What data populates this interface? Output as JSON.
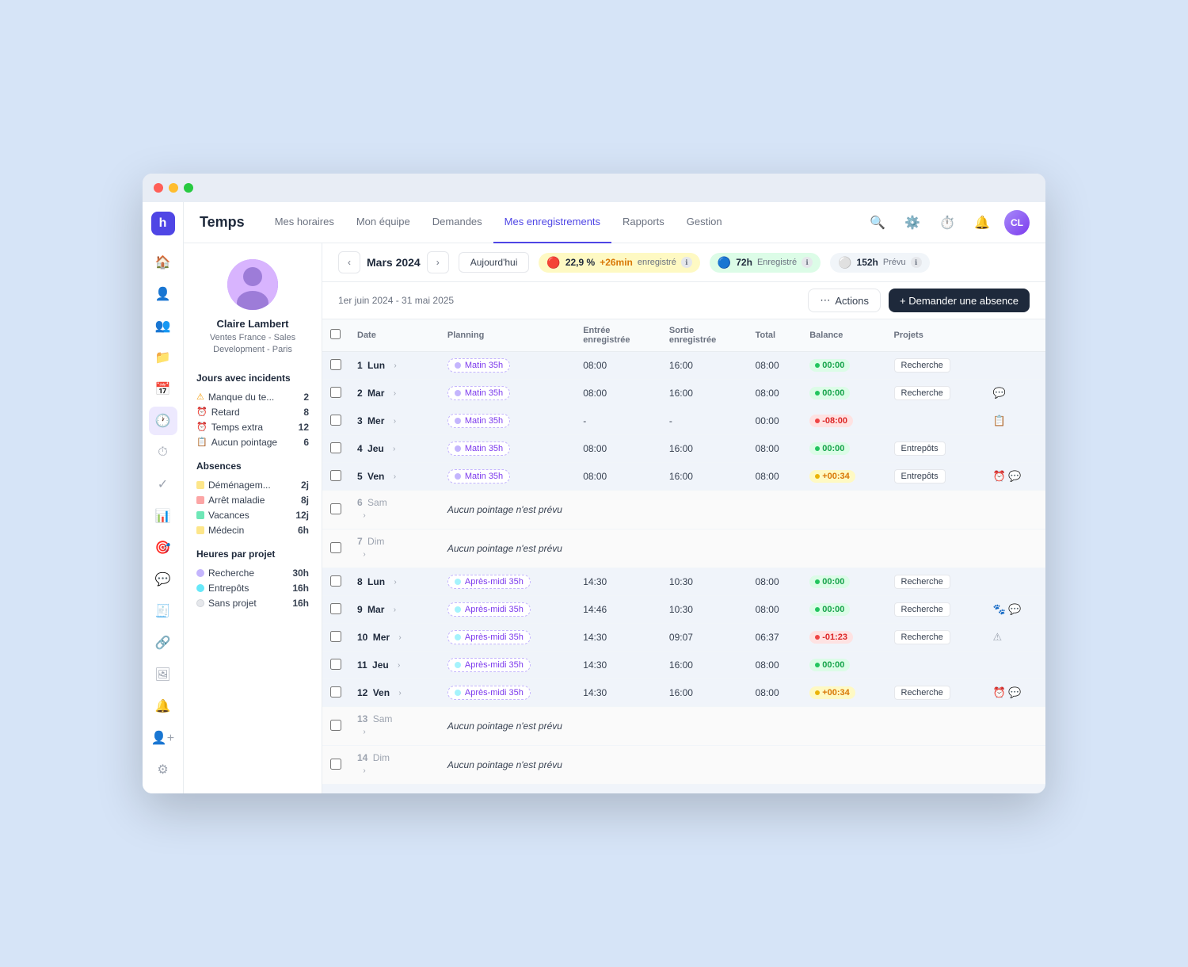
{
  "app": {
    "logo": "h",
    "title": "Temps"
  },
  "topbar": {
    "title": "Temps",
    "nav": [
      {
        "label": "Mes horaires",
        "active": false
      },
      {
        "label": "Mon équipe",
        "active": false
      },
      {
        "label": "Demandes",
        "active": false
      },
      {
        "label": "Mes enregistrements",
        "active": true
      },
      {
        "label": "Rapports",
        "active": false
      },
      {
        "label": "Gestion",
        "active": false
      }
    ]
  },
  "profile": {
    "name": "Claire Lambert",
    "dept": "Ventes France - Sales Development - Paris"
  },
  "date_nav": {
    "prev": "‹",
    "next": "›",
    "current": "Mars 2024",
    "today": "Aujourd'hui"
  },
  "stats": [
    {
      "icon": "🔴",
      "value": "22,9 %",
      "extra": "+26min",
      "label": "enregistré"
    },
    {
      "icon": "🔵",
      "value": "72h",
      "label": "Enregistré"
    },
    {
      "icon": "⚪",
      "value": "152h",
      "label": "Prévu"
    }
  ],
  "date_range": "1er juin 2024 - 31 mai 2025",
  "actions_label": "Actions",
  "request_absence_label": "+ Demander une absence",
  "incidents": {
    "title": "Jours avec incidents",
    "items": [
      {
        "icon": "⚠",
        "label": "Manque du te...",
        "count": "2"
      },
      {
        "icon": "⏰",
        "label": "Retard",
        "count": "8"
      },
      {
        "icon": "⏰",
        "label": "Temps extra",
        "count": "12"
      },
      {
        "icon": "📋",
        "label": "Aucun pointage",
        "count": "6"
      }
    ]
  },
  "absences": {
    "title": "Absences",
    "items": [
      {
        "color": "#fde68a",
        "label": "Déménagem...",
        "value": "2j"
      },
      {
        "color": "#fca5a5",
        "label": "Arrêt maladie",
        "value": "8j"
      },
      {
        "color": "#6ee7b7",
        "label": "Vacances",
        "value": "12j"
      },
      {
        "color": "#fde68a",
        "label": "Médecin",
        "value": "6h"
      }
    ]
  },
  "projects": {
    "title": "Heures par projet",
    "items": [
      {
        "color": "#c4b5fd",
        "label": "Recherche",
        "value": "30h"
      },
      {
        "color": "#67e8f9",
        "label": "Entrepôts",
        "value": "16h"
      },
      {
        "color": "#e5e7eb",
        "label": "Sans projet",
        "value": "16h"
      }
    ]
  },
  "table": {
    "headers": [
      "",
      "Date",
      "Planning",
      "Entrée enregistrée",
      "Sortie enregistrée",
      "Total",
      "Balance",
      "Projets",
      ""
    ],
    "rows": [
      {
        "num": "1",
        "day": "Lun",
        "weekend": false,
        "planning": "Matin 35h",
        "planning_type": "am",
        "entry": "08:00",
        "exit": "16:00",
        "total": "08:00",
        "balance_val": "00:00",
        "balance_type": "green",
        "projects": [
          "Recherche"
        ],
        "icons": [],
        "no_schedule": false
      },
      {
        "num": "2",
        "day": "Mar",
        "weekend": false,
        "planning": "Matin 35h",
        "planning_type": "am",
        "entry": "08:00",
        "exit": "16:00",
        "total": "08:00",
        "balance_val": "00:00",
        "balance_type": "green",
        "projects": [
          "Recherche"
        ],
        "icons": [
          "💬"
        ],
        "no_schedule": false
      },
      {
        "num": "3",
        "day": "Mer",
        "weekend": false,
        "planning": "Matin 35h",
        "planning_type": "am",
        "entry": "-",
        "exit": "-",
        "total": "00:00",
        "balance_val": "-08:00",
        "balance_type": "red",
        "projects": [],
        "icons": [
          "📋"
        ],
        "no_schedule": false
      },
      {
        "num": "4",
        "day": "Jeu",
        "weekend": false,
        "planning": "Matin 35h",
        "planning_type": "am",
        "entry": "08:00",
        "exit": "16:00",
        "total": "08:00",
        "balance_val": "00:00",
        "balance_type": "green",
        "projects": [
          "Entrepôts"
        ],
        "icons": [],
        "no_schedule": false
      },
      {
        "num": "5",
        "day": "Ven",
        "weekend": false,
        "planning": "Matin 35h",
        "planning_type": "am",
        "entry": "08:00",
        "exit": "16:00",
        "total": "08:00",
        "balance_val": "+00:34",
        "balance_type": "yellow",
        "projects": [
          "Entrepôts"
        ],
        "icons": [
          "⏰",
          "💬"
        ],
        "no_schedule": false
      },
      {
        "num": "6",
        "day": "Sam",
        "weekend": true,
        "planning": "",
        "planning_type": "",
        "entry": "",
        "exit": "",
        "total": "",
        "balance_val": "",
        "balance_type": "",
        "projects": [],
        "icons": [],
        "no_schedule": true,
        "no_schedule_text": "Aucun pointage n'est prévu"
      },
      {
        "num": "7",
        "day": "Dim",
        "weekend": true,
        "planning": "",
        "planning_type": "",
        "entry": "",
        "exit": "",
        "total": "",
        "balance_val": "",
        "balance_type": "",
        "projects": [],
        "icons": [],
        "no_schedule": true,
        "no_schedule_text": "Aucun pointage n'est prévu"
      },
      {
        "num": "8",
        "day": "Lun",
        "weekend": false,
        "planning": "Après-midi 35h",
        "planning_type": "pm",
        "entry": "14:30",
        "exit": "10:30",
        "total": "08:00",
        "balance_val": "00:00",
        "balance_type": "green",
        "projects": [
          "Recherche"
        ],
        "icons": [],
        "no_schedule": false
      },
      {
        "num": "9",
        "day": "Mar",
        "weekend": false,
        "planning": "Après-midi 35h",
        "planning_type": "pm",
        "entry": "14:46",
        "exit": "10:30",
        "total": "08:00",
        "balance_val": "00:00",
        "balance_type": "green",
        "projects": [
          "Recherche"
        ],
        "icons": [
          "🐾",
          "💬"
        ],
        "no_schedule": false
      },
      {
        "num": "10",
        "day": "Mer",
        "weekend": false,
        "planning": "Après-midi 35h",
        "planning_type": "pm",
        "entry": "14:30",
        "exit": "09:07",
        "total": "06:37",
        "balance_val": "-01:23",
        "balance_type": "red",
        "projects": [
          "Recherche"
        ],
        "icons": [
          "⚠"
        ],
        "no_schedule": false
      },
      {
        "num": "11",
        "day": "Jeu",
        "weekend": false,
        "planning": "Après-midi 35h",
        "planning_type": "pm",
        "entry": "14:30",
        "exit": "16:00",
        "total": "08:00",
        "balance_val": "00:00",
        "balance_type": "green",
        "projects": [],
        "icons": [],
        "no_schedule": false
      },
      {
        "num": "12",
        "day": "Ven",
        "weekend": false,
        "planning": "Après-midi 35h",
        "planning_type": "pm",
        "entry": "14:30",
        "exit": "16:00",
        "total": "08:00",
        "balance_val": "+00:34",
        "balance_type": "yellow",
        "projects": [
          "Recherche"
        ],
        "icons": [
          "⏰",
          "💬"
        ],
        "no_schedule": false
      },
      {
        "num": "13",
        "day": "Sam",
        "weekend": true,
        "planning": "",
        "planning_type": "",
        "entry": "",
        "exit": "",
        "total": "",
        "balance_val": "",
        "balance_type": "",
        "projects": [],
        "icons": [],
        "no_schedule": true,
        "no_schedule_text": "Aucun pointage n'est prévu"
      },
      {
        "num": "14",
        "day": "Dim",
        "weekend": true,
        "planning": "",
        "planning_type": "",
        "entry": "",
        "exit": "",
        "total": "",
        "balance_val": "",
        "balance_type": "",
        "projects": [],
        "icons": [],
        "no_schedule": true,
        "no_schedule_text": "Aucun pointage n'est prévu"
      }
    ]
  }
}
